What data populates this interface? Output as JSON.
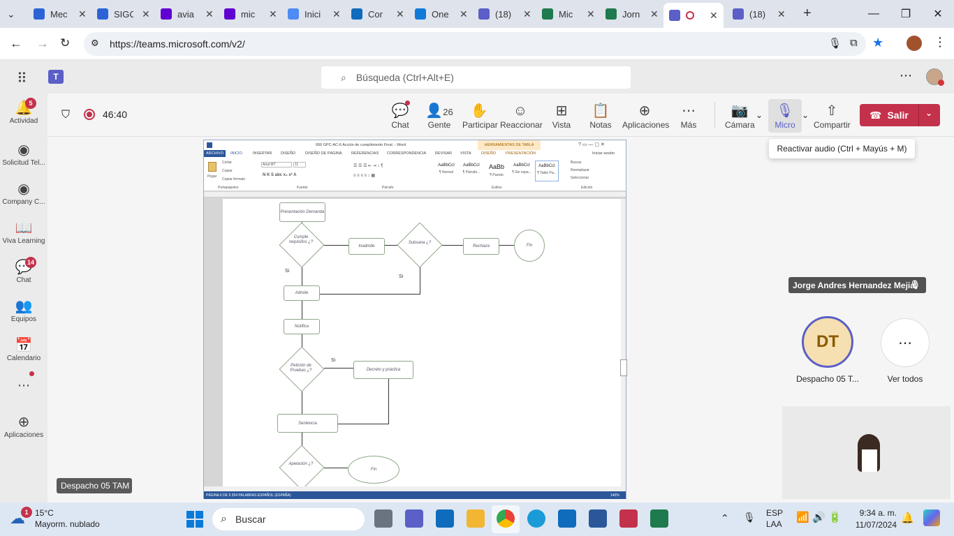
{
  "browser": {
    "tabs": [
      {
        "label": "Mec",
        "color": "#2b63d6"
      },
      {
        "label": "SIGC",
        "color": "#2b63d6"
      },
      {
        "label": "avia",
        "color": "#6001d2"
      },
      {
        "label": "mic",
        "color": "#6001d2"
      },
      {
        "label": "Inici",
        "color": "#4f8bf5"
      },
      {
        "label": "Cor",
        "color": "#0f6cbd"
      },
      {
        "label": "One",
        "color": "#0f7ad9"
      },
      {
        "label": "(18)",
        "color": "#5b5fc7"
      },
      {
        "label": "Mic",
        "color": "#1f7a4d"
      },
      {
        "label": "Jorn",
        "color": "#1f7a4d"
      },
      {
        "label": "",
        "color": "#5b5fc7"
      },
      {
        "label": "(18)",
        "color": "#5b5fc7"
      }
    ],
    "url": "https://teams.microsoft.com/v2/"
  },
  "teams": {
    "search_placeholder": "Búsqueda (Ctrl+Alt+E)",
    "rail": [
      {
        "label": "Actividad",
        "icon": "bell-icon",
        "badge": "5"
      },
      {
        "label": "Solicitud Tel...",
        "icon": "app-icon",
        "badge": ""
      },
      {
        "label": "Company C...",
        "icon": "app-icon",
        "badge": ""
      },
      {
        "label": "Viva Learning",
        "icon": "book-icon",
        "badge": ""
      },
      {
        "label": "Chat",
        "icon": "chat-icon",
        "badge": "14"
      },
      {
        "label": "Equipos",
        "icon": "teams-icon",
        "badge": ""
      },
      {
        "label": "Calendario",
        "icon": "calendar-icon",
        "badge": ""
      },
      {
        "label": "Aplicaciones",
        "icon": "plus-icon",
        "badge": ""
      }
    ],
    "meeting": {
      "timer": "46:40",
      "people_count": "26",
      "buttons": {
        "chat": "Chat",
        "people": "Gente",
        "raise": "Participar",
        "react": "Reaccionar",
        "view": "Vista",
        "notes": "Notas",
        "apps": "Aplicaciones",
        "more": "Más",
        "camera": "Cámara",
        "mic": "Micro",
        "share": "Compartir",
        "leave": "Salir"
      },
      "tooltip": "Reactivar audio (Ctrl + Mayús + M)",
      "presenter": "Jorge Andres Hernandez Mejia",
      "avatar_initials": "DT",
      "avatar_name": "Despacho 05 T...",
      "see_all": "Ver todos",
      "nameplate": "Despacho 05 TAM"
    }
  },
  "word": {
    "title": "006 GPC-AC-6 Acción de cumplimiento Final. - Word",
    "context_tab": "HERRAMIENTAS DE TABLA",
    "sign_in": "Iniciar sesión",
    "tabs": [
      "ARCHIVO",
      "INICIO",
      "INSERTAR",
      "DISEÑO",
      "DISEÑO DE PÁGINA",
      "REFERENCIAS",
      "CORRESPONDENCIA",
      "REVISAR",
      "VISTA",
      "DISEÑO",
      "PRESENTACIÓN"
    ],
    "font": "Arial MT",
    "size": "11",
    "clipboard": [
      "Cortar",
      "Copiar",
      "Copiar formato"
    ],
    "paste": "Pegar",
    "groups": [
      "Portapapeles",
      "Fuente",
      "Párrafo",
      "Estilos",
      "Edición"
    ],
    "styles": [
      "¶ Normal",
      "¶ Párrafo...",
      "¶ Puesto",
      "¶ Sin espa...",
      "¶ Table Pa..."
    ],
    "style_sample": "AaBbCcI",
    "style_sample2": "AaBb",
    "editing": [
      "Buscar",
      "Reemplazar",
      "Seleccionar"
    ],
    "status": "PÁGINA 6 DE 9    354 PALABRAS    ESPAÑOL (ESPAÑA)",
    "zoom": "140%",
    "flow": {
      "presentacion": "Presentación Demanda",
      "cumple": "Cumple requisitos ¿?",
      "inadmite": "Inadmite",
      "subsana": "Subsana ¿?",
      "rechaza": "Rechaza",
      "fin1": "Fin",
      "si1": "Si",
      "si2": "Si",
      "admite": "Admite",
      "notifica": "Notifica",
      "peticion": "Petición de Pruebas ¿?",
      "si3": "Si",
      "decreto": "Decreto y práctica",
      "sentencia": "Sentencia",
      "apelacion": "Apelación ¿?",
      "fin2": "Fin"
    }
  },
  "taskbar": {
    "weather_temp": "15°C",
    "weather_desc": "Mayorm. nublado",
    "weather_badge": "1",
    "search": "Buscar",
    "lang": "ESP",
    "lang2": "LAA",
    "time": "9:34 a. m.",
    "date": "11/07/2024"
  }
}
